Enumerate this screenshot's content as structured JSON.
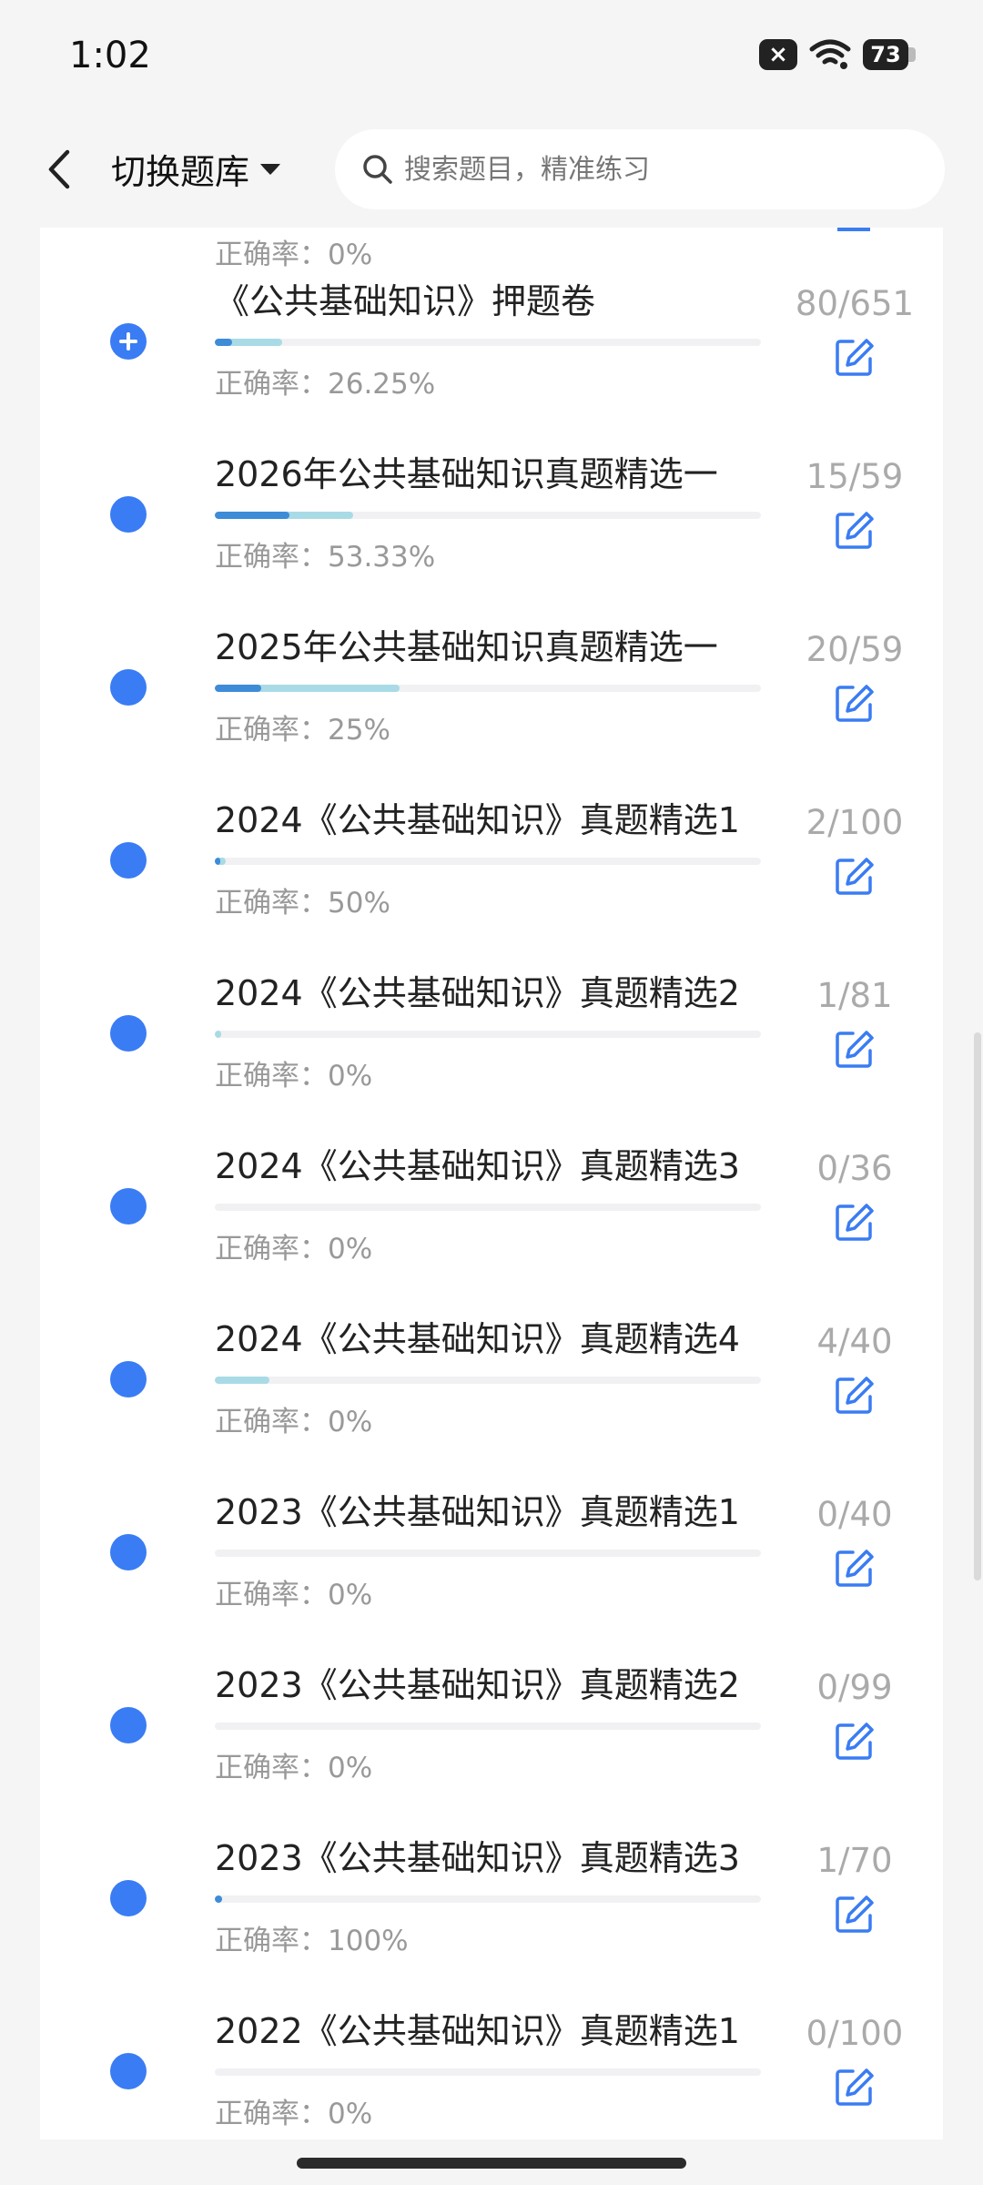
{
  "status_bar": {
    "time": "1:02",
    "battery_level": "73",
    "sim_status": "×"
  },
  "header": {
    "back_icon": "chevron-left-icon",
    "switch_label": "切换题库",
    "search_placeholder": "搜索题目，精准练习"
  },
  "colors": {
    "accent": "#3a7cf3",
    "progress_answered": "#a9dbe6",
    "progress_correct": "#3e8cd8",
    "muted_text": "#999999"
  },
  "list": {
    "partial_top_accuracy": "正确率：0%",
    "items": [
      {
        "title": "《公共基础知识》押题卷",
        "accuracy": "正确率：26.25%",
        "count": "80/651",
        "answered_fraction": 0.123,
        "correct_fraction": 0.032,
        "marker": "plus"
      },
      {
        "title": "2026年公共基础知识真题精选一",
        "accuracy": "正确率：53.33%",
        "count": "15/59",
        "answered_fraction": 0.254,
        "correct_fraction": 0.136,
        "marker": "dot"
      },
      {
        "title": "2025年公共基础知识真题精选一",
        "accuracy": "正确率：25%",
        "count": "20/59",
        "answered_fraction": 0.339,
        "correct_fraction": 0.085,
        "marker": "dot"
      },
      {
        "title": "2024《公共基础知识》真题精选1",
        "accuracy": "正确率：50%",
        "count": "2/100",
        "answered_fraction": 0.02,
        "correct_fraction": 0.01,
        "marker": "dot"
      },
      {
        "title": "2024《公共基础知识》真题精选2",
        "accuracy": "正确率：0%",
        "count": "1/81",
        "answered_fraction": 0.012,
        "correct_fraction": 0.0,
        "marker": "dot"
      },
      {
        "title": "2024《公共基础知识》真题精选3",
        "accuracy": "正确率：0%",
        "count": "0/36",
        "answered_fraction": 0.0,
        "correct_fraction": 0.0,
        "marker": "dot"
      },
      {
        "title": "2024《公共基础知识》真题精选4",
        "accuracy": "正确率：0%",
        "count": "4/40",
        "answered_fraction": 0.1,
        "correct_fraction": 0.0,
        "marker": "dot"
      },
      {
        "title": "2023《公共基础知识》真题精选1",
        "accuracy": "正确率：0%",
        "count": "0/40",
        "answered_fraction": 0.0,
        "correct_fraction": 0.0,
        "marker": "dot"
      },
      {
        "title": "2023《公共基础知识》真题精选2",
        "accuracy": "正确率：0%",
        "count": "0/99",
        "answered_fraction": 0.0,
        "correct_fraction": 0.0,
        "marker": "dot"
      },
      {
        "title": "2023《公共基础知识》真题精选3",
        "accuracy": "正确率：100%",
        "count": "1/70",
        "answered_fraction": 0.014,
        "correct_fraction": 0.014,
        "marker": "dot"
      },
      {
        "title": "2022《公共基础知识》真题精选1",
        "accuracy": "正确率：0%",
        "count": "0/100",
        "answered_fraction": 0.0,
        "correct_fraction": 0.0,
        "marker": "dot"
      }
    ]
  }
}
